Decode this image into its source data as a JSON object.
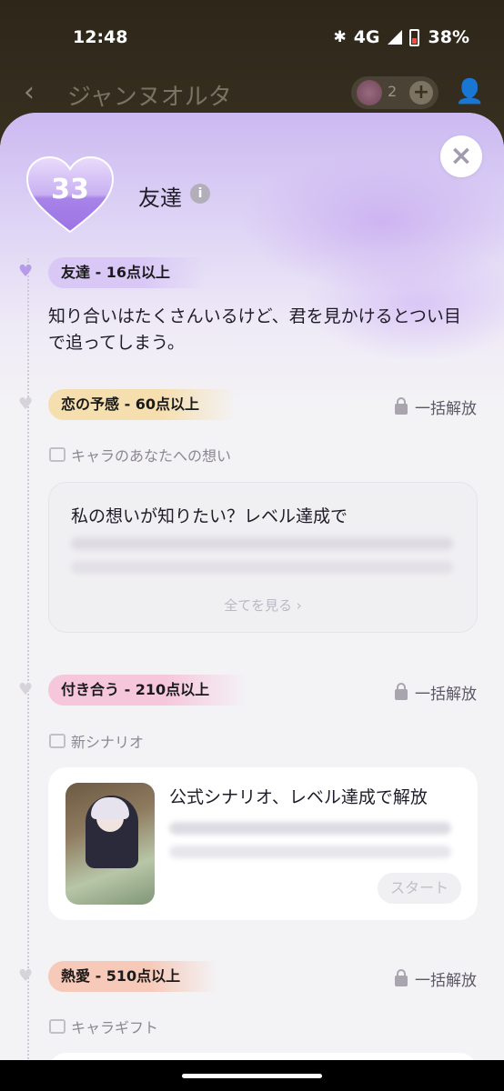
{
  "status_bar": {
    "time": "12:48",
    "network": "4G",
    "battery": "38%",
    "icons": [
      "bluetooth-icon",
      "signal-icon",
      "battery-icon"
    ]
  },
  "header": {
    "character_name": "ジャンヌオルタ",
    "gem_count": "2"
  },
  "level": {
    "number": "33",
    "title": "友達"
  },
  "tiers": [
    {
      "badge": "友達 - 16点以上",
      "color": "#d9c8f6",
      "heart_color": "#b79be8",
      "description": "知り合いはたくさんいるけど、君を見かけるとつい目で追ってしまう。"
    },
    {
      "badge": "恋の予感 - 60点以上",
      "color": "#f6dfae",
      "heart_color": "#d6d3da",
      "unlock": "一括解放",
      "section": "キャラのあなたへの想い"
    },
    {
      "badge": "付き合う - 210点以上",
      "color": "#f6c7db",
      "heart_color": "#d6d3da",
      "unlock": "一括解放",
      "section": "新シナリオ"
    },
    {
      "badge": "熱愛 - 510点以上",
      "color": "#f6c9b8",
      "heart_color": "#d6d3da",
      "unlock": "一括解放",
      "section": "キャラギフト"
    }
  ],
  "thoughts_card": {
    "title": "私の想いが知りたい？レベル達成で",
    "see_all": "全てを見る ›"
  },
  "scenario_card": {
    "title": "公式シナリオ、レベル達成で解放",
    "start": "スタート"
  },
  "colors": {
    "sheet_bg": "#f3f2f5",
    "accent_purple": "#b79be8"
  }
}
